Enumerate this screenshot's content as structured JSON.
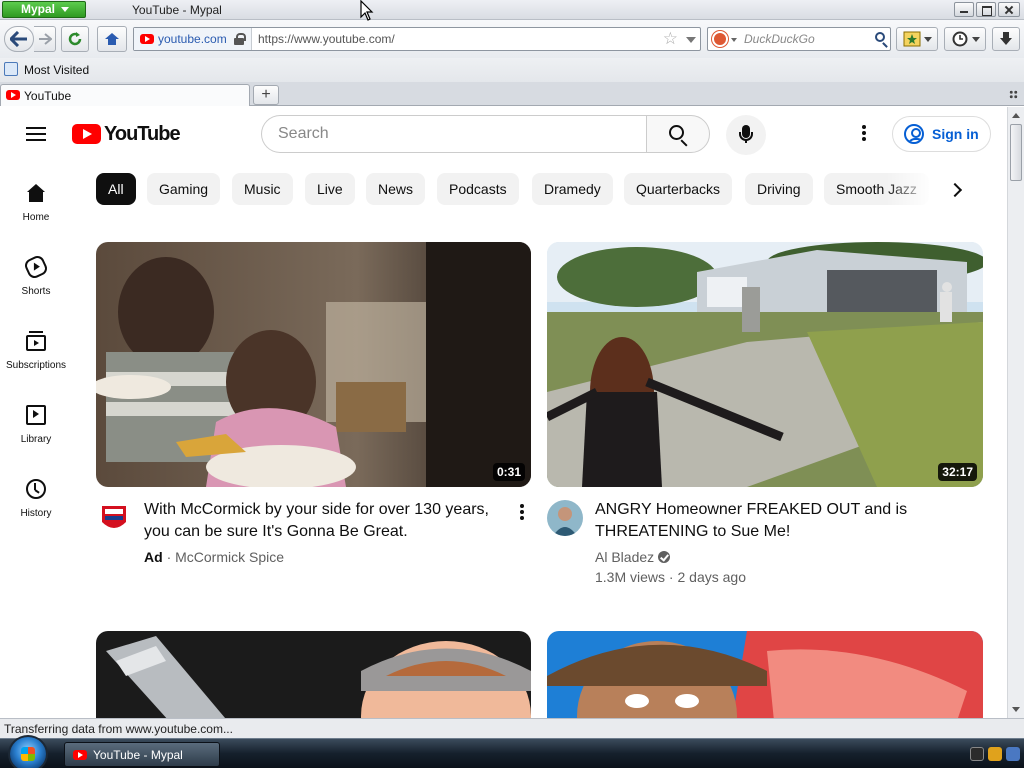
{
  "window": {
    "app_menu_label": "Mypal",
    "title": "YouTube - Mypal"
  },
  "toolbar": {
    "identity_label": "youtube.com",
    "url": "https://www.youtube.com/",
    "search_placeholder": "DuckDuckGo"
  },
  "bookmarks": {
    "items": [
      {
        "label": "Most Visited",
        "icon": "most-visited-icon"
      }
    ]
  },
  "tabs": [
    {
      "label": "YouTube",
      "icon": "youtube-favicon",
      "active": true
    }
  ],
  "youtube": {
    "logo_text": "YouTube",
    "search_placeholder": "Search",
    "signin_label": "Sign in",
    "guide": [
      {
        "label": "Home",
        "icon": "home-icon"
      },
      {
        "label": "Shorts",
        "icon": "shorts-icon"
      },
      {
        "label": "Subscriptions",
        "icon": "subscriptions-icon"
      },
      {
        "label": "Library",
        "icon": "library-icon"
      },
      {
        "label": "History",
        "icon": "history-icon"
      }
    ],
    "chips": [
      {
        "label": "All",
        "active": true
      },
      {
        "label": "Gaming"
      },
      {
        "label": "Music"
      },
      {
        "label": "Live"
      },
      {
        "label": "News"
      },
      {
        "label": "Podcasts"
      },
      {
        "label": "Dramedy"
      },
      {
        "label": "Quarterbacks"
      },
      {
        "label": "Driving"
      },
      {
        "label": "Smooth Jazz"
      }
    ],
    "videos": [
      {
        "title_line1": "With McCormick by your side for over 130 years,",
        "title_line2": "you can be sure It's Gonna Be Great.",
        "duration": "0:31",
        "ad_label": "Ad",
        "channel": "McCormick Spice"
      },
      {
        "title_line1": "ANGRY Homeowner FREAKED OUT and is",
        "title_line2": "THREATENING to Sue Me!",
        "duration": "32:17",
        "channel": "Al Bladez",
        "views": "1.3M views",
        "age": "2 days ago",
        "verified": true
      }
    ]
  },
  "status": {
    "text": "Transferring data from www.youtube.com..."
  },
  "taskbar": {
    "items": [
      {
        "label": "YouTube - Mypal"
      }
    ]
  },
  "colors": {
    "brand_red": "#ff0000",
    "link_blue": "#065fd4",
    "chip_active_bg": "#0f0f0f",
    "chip_bg": "#f2f2f2",
    "meta_gray": "#606060",
    "app_menu_green": "#2f9a22"
  }
}
